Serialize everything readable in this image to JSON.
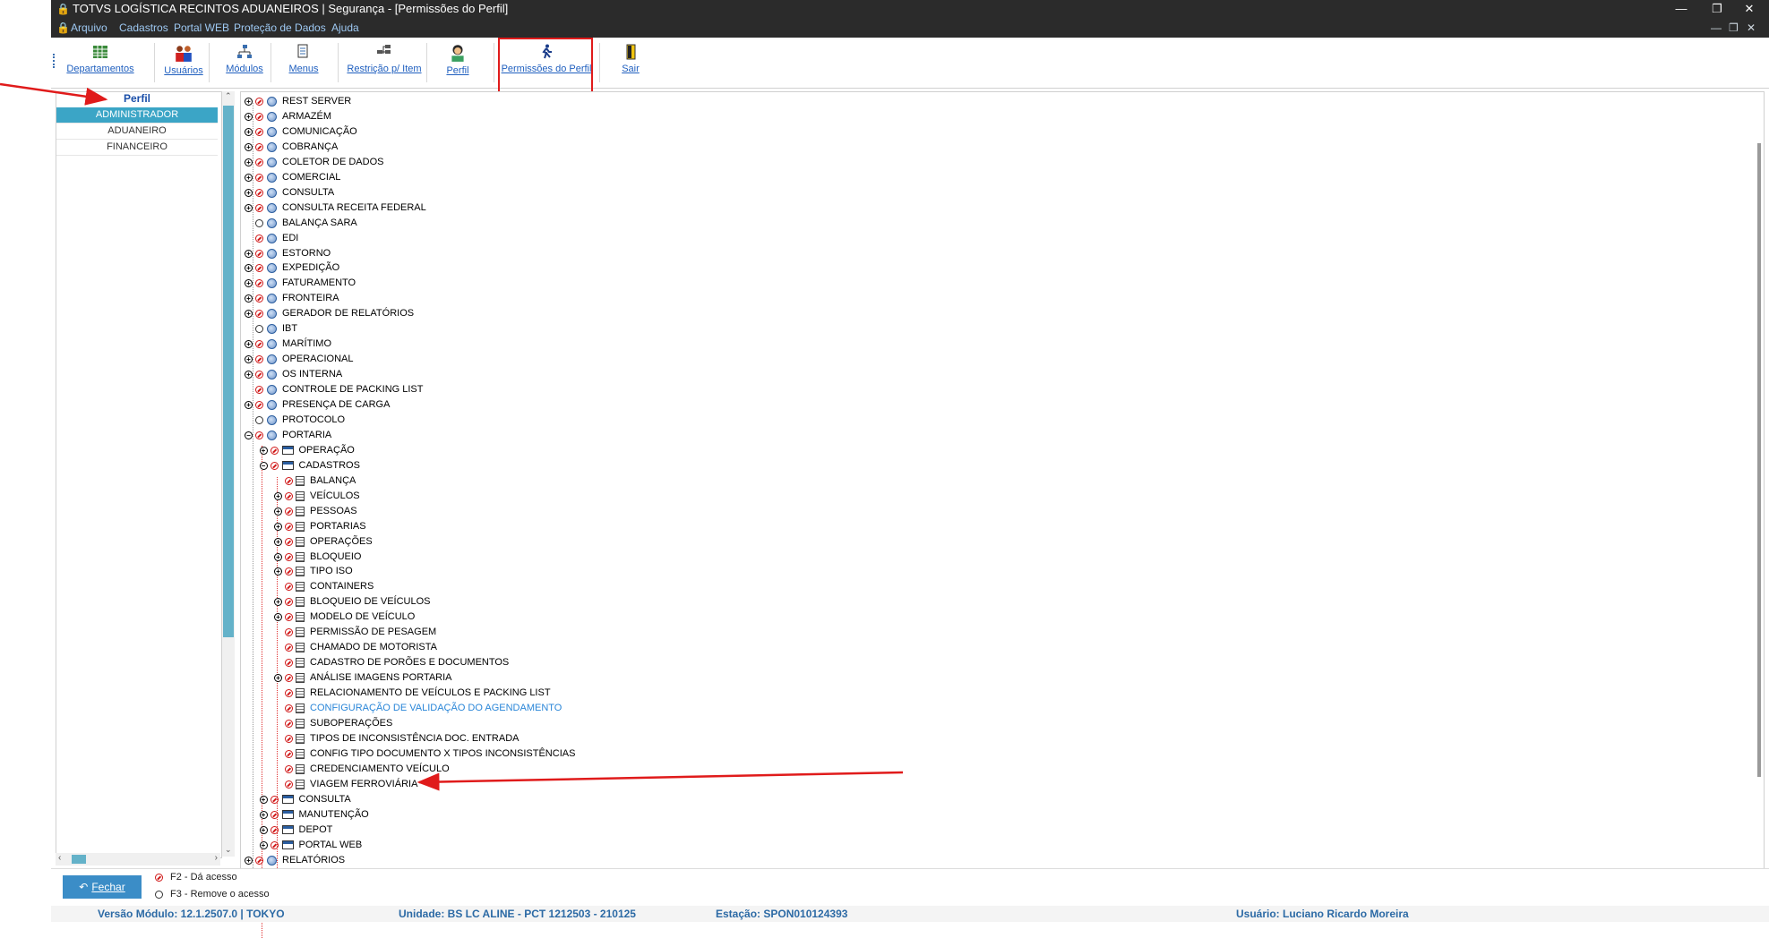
{
  "window": {
    "title": "TOTVS LOGÍSTICA RECINTOS ADUANEIROS | Segurança - [Permissões do Perfil]"
  },
  "menu": [
    "Arquivo",
    "Cadastros",
    "Portal WEB",
    "Proteção de Dados",
    "Ajuda"
  ],
  "toolbar": [
    {
      "label": "Departamentos",
      "icon": "grid-icon"
    },
    {
      "label": "Usuários",
      "icon": "users-icon"
    },
    {
      "label": "Módulos",
      "icon": "modules-icon"
    },
    {
      "label": "Menus",
      "icon": "menus-icon"
    },
    {
      "label": "Restrição p/ Item",
      "icon": "restriction-icon"
    },
    {
      "label": "Perfil",
      "icon": "profile-icon"
    },
    {
      "label": "Permissões do Perfil",
      "icon": "running-person-icon"
    },
    {
      "label": "Sair",
      "icon": "exit-door-icon"
    }
  ],
  "profiles": {
    "header": "Perfil",
    "items": [
      "ADMINISTRADOR",
      "ADUANEIRO",
      "FINANCEIRO"
    ],
    "selected": "ADMINISTRADOR"
  },
  "tree": [
    {
      "label": "REST SERVER",
      "level": 0,
      "expander": "plus",
      "check": "granted",
      "icon": "globe"
    },
    {
      "label": "ARMAZÉM",
      "level": 0,
      "expander": "plus",
      "check": "granted",
      "icon": "globe"
    },
    {
      "label": "COMUNICAÇÃO",
      "level": 0,
      "expander": "plus",
      "check": "granted",
      "icon": "globe"
    },
    {
      "label": "COBRANÇA",
      "level": 0,
      "expander": "plus",
      "check": "granted",
      "icon": "globe"
    },
    {
      "label": "COLETOR DE DADOS",
      "level": 0,
      "expander": "plus",
      "check": "granted",
      "icon": "globe"
    },
    {
      "label": "COMERCIAL",
      "level": 0,
      "expander": "plus",
      "check": "granted",
      "icon": "globe"
    },
    {
      "label": "CONSULTA",
      "level": 0,
      "expander": "plus",
      "check": "granted",
      "icon": "globe"
    },
    {
      "label": "CONSULTA RECEITA FEDERAL",
      "level": 0,
      "expander": "plus",
      "check": "granted",
      "icon": "globe"
    },
    {
      "label": "BALANÇA SARA",
      "level": 0,
      "expander": "none",
      "check": "empty",
      "icon": "globe"
    },
    {
      "label": "EDI",
      "level": 0,
      "expander": "none",
      "check": "granted",
      "icon": "globe"
    },
    {
      "label": "ESTORNO",
      "level": 0,
      "expander": "plus",
      "check": "granted",
      "icon": "globe"
    },
    {
      "label": "EXPEDIÇÃO",
      "level": 0,
      "expander": "plus",
      "check": "granted",
      "icon": "globe"
    },
    {
      "label": "FATURAMENTO",
      "level": 0,
      "expander": "plus",
      "check": "granted",
      "icon": "globe"
    },
    {
      "label": "FRONTEIRA",
      "level": 0,
      "expander": "plus",
      "check": "granted",
      "icon": "globe"
    },
    {
      "label": "GERADOR DE RELATÓRIOS",
      "level": 0,
      "expander": "plus",
      "check": "granted",
      "icon": "globe"
    },
    {
      "label": "IBT",
      "level": 0,
      "expander": "none",
      "check": "empty",
      "icon": "globe"
    },
    {
      "label": "MARÍTIMO",
      "level": 0,
      "expander": "plus",
      "check": "granted",
      "icon": "globe"
    },
    {
      "label": "OPERACIONAL",
      "level": 0,
      "expander": "plus",
      "check": "granted",
      "icon": "globe"
    },
    {
      "label": "OS INTERNA",
      "level": 0,
      "expander": "plus",
      "check": "granted",
      "icon": "globe"
    },
    {
      "label": "CONTROLE DE PACKING LIST",
      "level": 0,
      "expander": "none",
      "check": "granted",
      "icon": "globe"
    },
    {
      "label": "PRESENÇA DE CARGA",
      "level": 0,
      "expander": "plus",
      "check": "granted",
      "icon": "globe"
    },
    {
      "label": "PROTOCOLO",
      "level": 0,
      "expander": "none",
      "check": "empty",
      "icon": "globe"
    },
    {
      "label": "PORTARIA",
      "level": 0,
      "expander": "minus",
      "check": "granted",
      "icon": "globe"
    },
    {
      "label": "OPERAÇÃO",
      "level": 1,
      "expander": "plus",
      "check": "granted",
      "icon": "screen"
    },
    {
      "label": "CADASTROS",
      "level": 1,
      "expander": "minus",
      "check": "granted",
      "icon": "screen"
    },
    {
      "label": "BALANÇA",
      "level": 2,
      "expander": "none",
      "check": "granted",
      "icon": "form"
    },
    {
      "label": "VEÍCULOS",
      "level": 2,
      "expander": "plus",
      "check": "granted",
      "icon": "form"
    },
    {
      "label": "PESSOAS",
      "level": 2,
      "expander": "plus",
      "check": "granted",
      "icon": "form"
    },
    {
      "label": "PORTARIAS",
      "level": 2,
      "expander": "plus",
      "check": "granted",
      "icon": "form"
    },
    {
      "label": "OPERAÇÕES",
      "level": 2,
      "expander": "plus",
      "check": "granted",
      "icon": "form"
    },
    {
      "label": "BLOQUEIO",
      "level": 2,
      "expander": "plus",
      "check": "granted",
      "icon": "form"
    },
    {
      "label": "TIPO ISO",
      "level": 2,
      "expander": "plus",
      "check": "granted",
      "icon": "form"
    },
    {
      "label": "CONTAINERS",
      "level": 2,
      "expander": "none",
      "check": "granted",
      "icon": "form"
    },
    {
      "label": "BLOQUEIO DE VEÍCULOS",
      "level": 2,
      "expander": "plus",
      "check": "granted",
      "icon": "form"
    },
    {
      "label": "MODELO DE VEÍCULO",
      "level": 2,
      "expander": "plus",
      "check": "granted",
      "icon": "form"
    },
    {
      "label": "PERMISSÃO DE PESAGEM",
      "level": 2,
      "expander": "none",
      "check": "granted",
      "icon": "form"
    },
    {
      "label": "CHAMADO DE MOTORISTA",
      "level": 2,
      "expander": "none",
      "check": "granted",
      "icon": "form"
    },
    {
      "label": "CADASTRO DE PORÕES E DOCUMENTOS",
      "level": 2,
      "expander": "none",
      "check": "granted",
      "icon": "form"
    },
    {
      "label": "ANÁLISE IMAGENS PORTARIA",
      "level": 2,
      "expander": "plus",
      "check": "granted",
      "icon": "form"
    },
    {
      "label": "RELACIONAMENTO DE VEÍCULOS E PACKING LIST",
      "level": 2,
      "expander": "none",
      "check": "granted",
      "icon": "form"
    },
    {
      "label": "CONFIGURAÇÃO DE VALIDAÇÃO DO AGENDAMENTO",
      "level": 2,
      "expander": "none",
      "check": "granted",
      "icon": "form",
      "link": true
    },
    {
      "label": "SUBOPERAÇÕES",
      "level": 2,
      "expander": "none",
      "check": "granted",
      "icon": "form"
    },
    {
      "label": "TIPOS DE INCONSISTÊNCIA DOC. ENTRADA",
      "level": 2,
      "expander": "none",
      "check": "granted",
      "icon": "form"
    },
    {
      "label": "CONFIG TIPO DOCUMENTO X TIPOS INCONSISTÊNCIAS",
      "level": 2,
      "expander": "none",
      "check": "granted",
      "icon": "form"
    },
    {
      "label": "CREDENCIAMENTO VEÍCULO",
      "level": 2,
      "expander": "none",
      "check": "granted",
      "icon": "form"
    },
    {
      "label": "VIAGEM FERROVIÁRIA",
      "level": 2,
      "expander": "none",
      "check": "granted",
      "icon": "form"
    },
    {
      "label": "CONSULTA",
      "level": 1,
      "expander": "plus",
      "check": "granted",
      "icon": "screen"
    },
    {
      "label": "MANUTENÇÃO",
      "level": 1,
      "expander": "plus",
      "check": "granted",
      "icon": "screen"
    },
    {
      "label": "DEPOT",
      "level": 1,
      "expander": "plus",
      "check": "granted",
      "icon": "screen"
    },
    {
      "label": "PORTAL WEB",
      "level": 1,
      "expander": "plus",
      "check": "granted",
      "icon": "screen"
    },
    {
      "label": "RELATÓRIOS",
      "level": 0,
      "expander": "plus",
      "check": "granted",
      "icon": "globe"
    }
  ],
  "footer": {
    "close_label": "Fechar",
    "legend_grant": "F2 - Dá acesso",
    "legend_remove": "F3 - Remove o acesso"
  },
  "status": {
    "version": "Versão Módulo:  12.1.2507.0  |  TOKYO",
    "unit": "Unidade: BS LC ALINE - PCT 1212503 - 210125",
    "station": "Estação: SPON010124393",
    "user": "Usuário: Luciano Ricardo Moreira"
  },
  "colors": {
    "accent": "#3ba5c6",
    "annotation": "#e01b1b",
    "link": "#1f5fbf"
  }
}
